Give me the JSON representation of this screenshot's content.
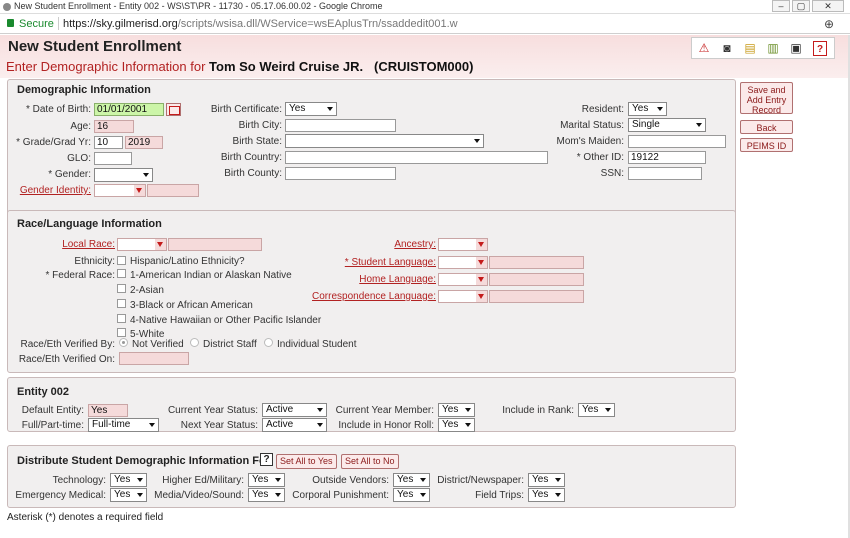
{
  "window": {
    "title": "New Student Enrollment - Entity 002 - WS\\ST\\PR - 11730 - 05.17.06.00.02 - Google Chrome",
    "minimize": "–",
    "restore": "▢",
    "close": "✕"
  },
  "address": {
    "secure_label": "Secure",
    "url_host": "https://sky.gilmerisd.org",
    "url_path": "/scripts/wsisa.dll/WService=wsEAplusTrn/ssaddedit001.w"
  },
  "header": {
    "title": "New Student Enrollment",
    "subtitle_prefix": "Enter Demographic Information for ",
    "student_name": "Tom So Weird Cruise JR.",
    "student_id": "(CRUISTOM000)"
  },
  "toolbar": {
    "icons": [
      "warning-icon",
      "camera-icon",
      "notes-icon",
      "documents-icon",
      "print-icon",
      "help-icon"
    ]
  },
  "side_buttons": {
    "save": "Save and Add Entry Record",
    "back": "Back",
    "peims": "PEIMS ID"
  },
  "demographic": {
    "title": "Demographic Information",
    "dob_label": "* Date of Birth:",
    "dob_value": "01/01/2001",
    "age_label": "Age:",
    "age_value": "16",
    "grade_label": "* Grade/Grad Yr:",
    "grade_value": "10",
    "grad_yr_value": "2019",
    "glo_label": "GLO:",
    "glo_value": "",
    "gender_label": "* Gender:",
    "gender_value": "",
    "gender_identity_label": "Gender Identity:",
    "birth_cert_label": "Birth Certificate:",
    "birth_cert_value": "Yes",
    "birth_city_label": "Birth City:",
    "birth_state_label": "Birth State:",
    "birth_country_label": "Birth Country:",
    "birth_county_label": "Birth County:",
    "resident_label": "Resident:",
    "resident_value": "Yes",
    "marital_label": "Marital Status:",
    "marital_value": "Single",
    "moms_maiden_label": "Mom's Maiden:",
    "other_id_label": "* Other ID:",
    "other_id_value": "19122",
    "ssn_label": "SSN:"
  },
  "race": {
    "title": "Race/Language Information",
    "local_race_label": "Local Race:",
    "ethnicity_label": "Ethnicity:",
    "hispanic_label": "Hispanic/Latino Ethnicity?",
    "federal_race_label": "* Federal Race:",
    "races": [
      "1-American Indian or Alaskan Native",
      "2-Asian",
      "3-Black or African American",
      "4-Native Hawaiian or Other Pacific Islander",
      "5-White"
    ],
    "verified_by_label": "Race/Eth Verified By:",
    "verified_options": [
      "Not Verified",
      "District Staff",
      "Individual Student"
    ],
    "verified_on_label": "Race/Eth Verified On:",
    "ancestry_label": "Ancestry:",
    "student_language_label": "* Student Language:",
    "home_language_label": "Home Language:",
    "correspondence_language_label": "Correspondence Language:"
  },
  "entity": {
    "title": "Entity 002",
    "default_entity_label": "Default Entity:",
    "default_entity_value": "Yes",
    "full_part_label": "Full/Part-time:",
    "full_part_value": "Full-time",
    "cy_status_label": "Current Year Status:",
    "cy_status_value": "Active",
    "ny_status_label": "Next Year Status:",
    "ny_status_value": "Active",
    "cy_member_label": "Current Year Member:",
    "cy_member_value": "Yes",
    "honor_roll_label": "Include in Honor Roll:",
    "honor_roll_value": "Yes",
    "rank_label": "Include in Rank:",
    "rank_value": "Yes"
  },
  "distribute": {
    "title": "Distribute Student Demographic Information For",
    "help_glyph": "?",
    "set_yes": "Set All to Yes",
    "set_no": "Set All to No",
    "technology_label": "Technology:",
    "technology_value": "Yes",
    "emergency_label": "Emergency Medical:",
    "emergency_value": "Yes",
    "higher_ed_label": "Higher Ed/Military:",
    "higher_ed_value": "Yes",
    "media_label": "Media/Video/Sound:",
    "media_value": "Yes",
    "vendors_label": "Outside Vendors:",
    "vendors_value": "Yes",
    "corporal_label": "Corporal Punishment:",
    "corporal_value": "Yes",
    "newspaper_label": "District/Newspaper:",
    "newspaper_value": "Yes",
    "field_trips_label": "Field Trips:",
    "field_trips_value": "Yes"
  },
  "footer": {
    "note": "Asterisk (*) denotes a required field"
  },
  "colors": {
    "accent_red": "#b22222",
    "header_pink": "#f7dede",
    "panel_bg": "#f1efef",
    "dob_highlight": "#ccf5a8"
  }
}
